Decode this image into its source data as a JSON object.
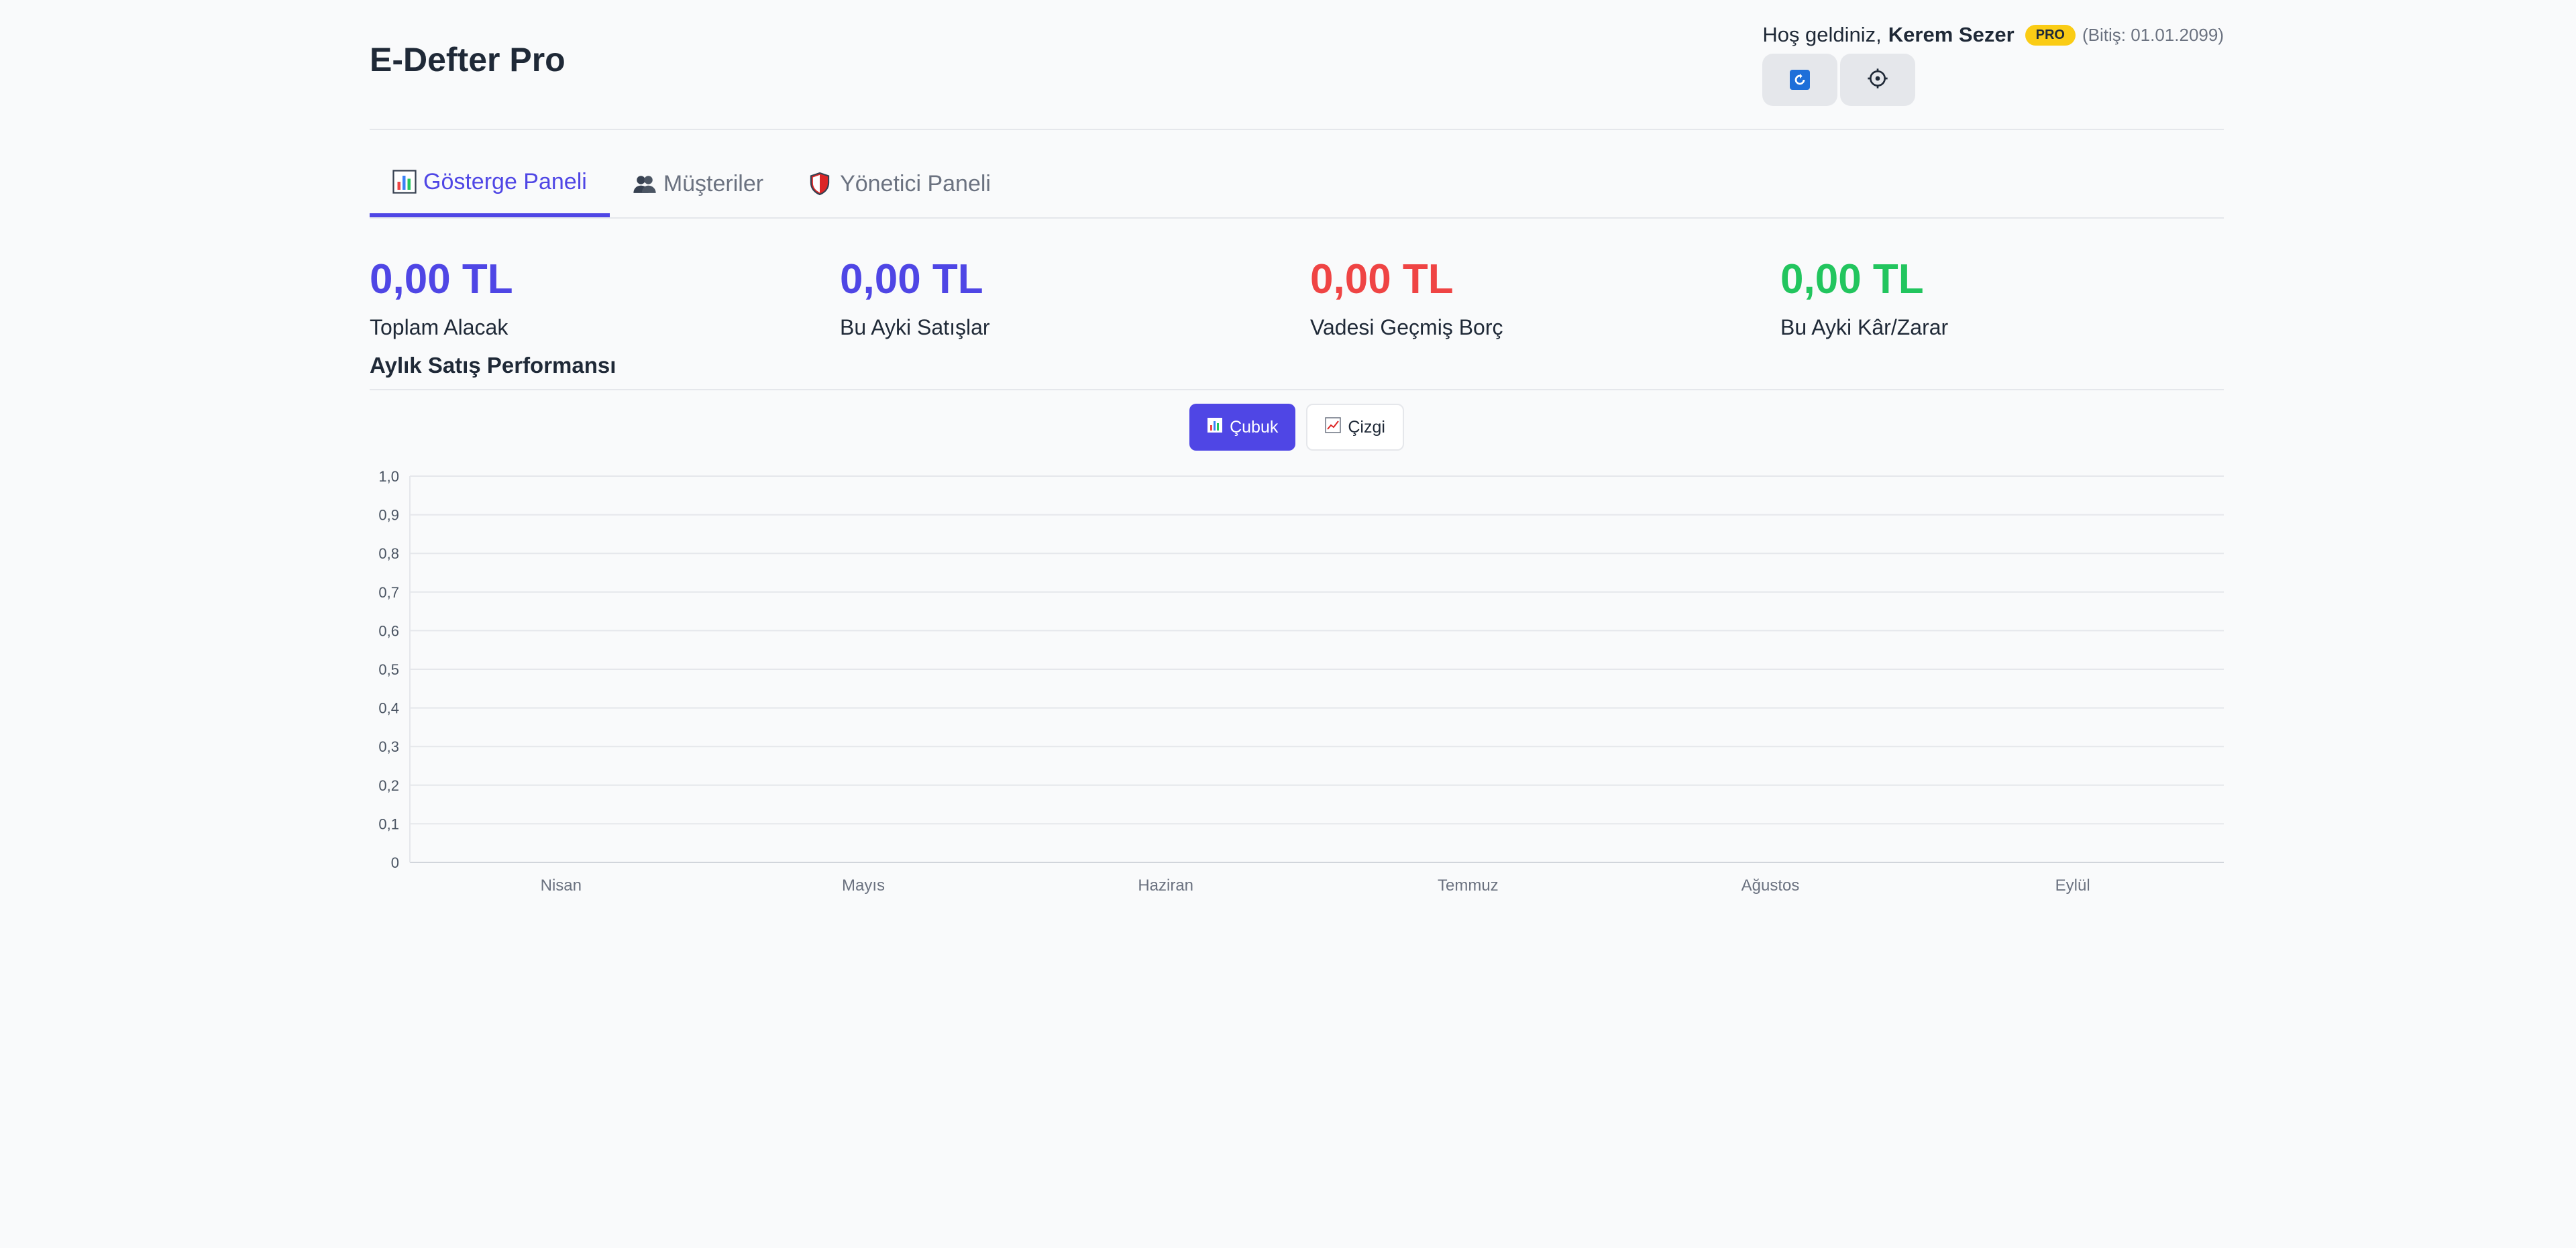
{
  "header": {
    "title": "E-Defter Pro",
    "welcome": "Hoş geldiniz,",
    "user_name": "Kerem Sezer",
    "badge": "PRO",
    "expiry": "(Bitiş: 01.01.2099)",
    "icons": [
      "refresh-icon",
      "gear-icon"
    ]
  },
  "tabs": [
    {
      "label": "Gösterge Paneli",
      "icon": "chart-icon",
      "active": true
    },
    {
      "label": "Müşteriler",
      "icon": "users-icon",
      "active": false
    },
    {
      "label": "Yönetici Paneli",
      "icon": "shield-icon",
      "active": false
    }
  ],
  "stats": [
    {
      "value": "0,00 TL",
      "label": "Toplam Alacak",
      "color": "#4f46e5"
    },
    {
      "value": "0,00 TL",
      "label": "Bu Ayki Satışlar",
      "color": "#4f46e5"
    },
    {
      "value": "0,00 TL",
      "label": "Vadesi Geçmiş Borç",
      "color": "#ef4444"
    },
    {
      "value": "0,00 TL",
      "label": "Bu Ayki Kâr/Zarar",
      "color": "#22c55e"
    }
  ],
  "chart": {
    "section_title": "Aylık Satış Performansı",
    "toggle": {
      "bar_label": "Çubuk",
      "line_label": "Çizgi",
      "selected": "bar"
    }
  },
  "chart_data": {
    "type": "bar",
    "categories": [
      "Nisan",
      "Mayıs",
      "Haziran",
      "Temmuz",
      "Ağustos",
      "Eylül"
    ],
    "values": [
      0,
      0,
      0,
      0,
      0,
      0
    ],
    "ylim": [
      0,
      1
    ],
    "yticks": [
      "0",
      "0,1",
      "0,2",
      "0,3",
      "0,4",
      "0,5",
      "0,6",
      "0,7",
      "0,8",
      "0,9",
      "1,0"
    ],
    "grid": true,
    "legend": "none"
  }
}
